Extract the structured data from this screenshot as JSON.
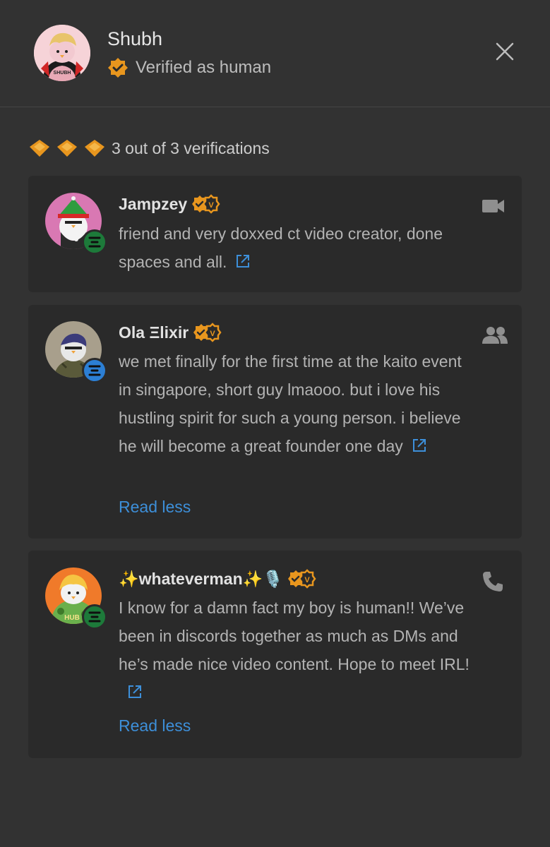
{
  "header": {
    "name": "Shubh",
    "verified_label": "Verified as human",
    "avatar_text": "SHUBH"
  },
  "summary": {
    "text": "3 out of 3 verifications"
  },
  "colors": {
    "badge": "#e8961e",
    "link": "#3d8fd9",
    "elixir_green": "#1d7a3a",
    "elixir_blue": "#2c7fd4"
  },
  "verifications": [
    {
      "name": "Jampzey",
      "text": "friend and very doxxed ct video creator, done spaces and all.",
      "type_icon": "video-camera-icon",
      "platform_icon": "elixir-logo-icon"
    },
    {
      "name": "Ola Ξlixir",
      "text": "we met finally for the first time at the kaito event in singapore, short guy lmaooo. but i love his hustling spirit for such a young person. i believe he will become a great founder one day",
      "read_less": "Read less",
      "type_icon": "people-icon",
      "platform_icon": "elixir-logo-icon"
    },
    {
      "name": "✨whateverman✨🎙️",
      "text": "I know for a damn fact my boy is human!! We’ve been in discords together as much as DMs and he’s made nice video content. Hope to meet IRL!",
      "read_less": "Read less",
      "type_icon": "phone-icon",
      "platform_icon": "elixir-logo-icon",
      "avatar_text": "HUB"
    }
  ]
}
